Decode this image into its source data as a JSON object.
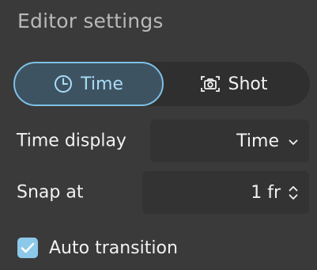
{
  "panel": {
    "title": "Editor settings"
  },
  "mode_toggle": {
    "options": [
      {
        "label": "Time",
        "icon": "clock-icon",
        "selected": true
      },
      {
        "label": "Shot",
        "icon": "camera-icon",
        "selected": false
      }
    ]
  },
  "time_display": {
    "label": "Time display",
    "value": "Time"
  },
  "snap_at": {
    "label": "Snap at",
    "value": "1 fr"
  },
  "auto_transition": {
    "label": "Auto transition",
    "checked": true
  },
  "colors": {
    "background": "#3a3a3a",
    "accent": "#8cc8ea",
    "selected_segment": "#3e5362"
  }
}
